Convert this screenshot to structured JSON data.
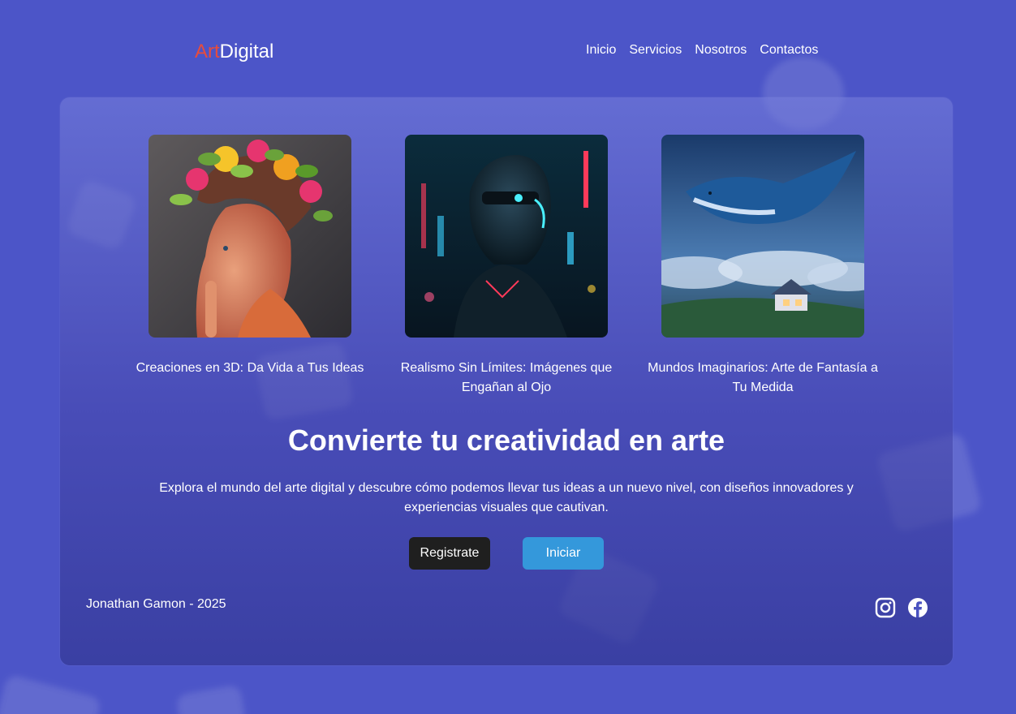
{
  "brand": {
    "part1": "Art",
    "part2": "Digital",
    "accent_color": "#e74c3c"
  },
  "nav": [
    {
      "label": "Inicio"
    },
    {
      "label": "Servicios"
    },
    {
      "label": "Nosotros"
    },
    {
      "label": "Contactos"
    }
  ],
  "gallery": [
    {
      "caption": "Creaciones en 3D: Da Vida a Tus Ideas",
      "image": "woman-flower-crown-illustration"
    },
    {
      "caption": "Realismo Sin Límites: Imágenes que Engañan al Ojo",
      "image": "cyberpunk-robot-illustration"
    },
    {
      "caption": "Mundos Imaginarios: Arte de Fantasía a Tu Medida",
      "image": "flying-whale-illustration"
    }
  ],
  "hero": {
    "title": "Convierte tu creatividad en arte",
    "description": "Explora el mundo del arte digital y descubre cómo podemos llevar tus ideas a un nuevo nivel, con diseños innovadores y experiencias visuales que cautivan."
  },
  "buttons": {
    "register": "Registrate",
    "start": "Iniciar",
    "start_color": "#3498db",
    "register_color": "#1f1f1f"
  },
  "footer": {
    "credit": "Jonathan Gamon - 2025",
    "social_icons": [
      "instagram-icon",
      "facebook-icon"
    ]
  }
}
